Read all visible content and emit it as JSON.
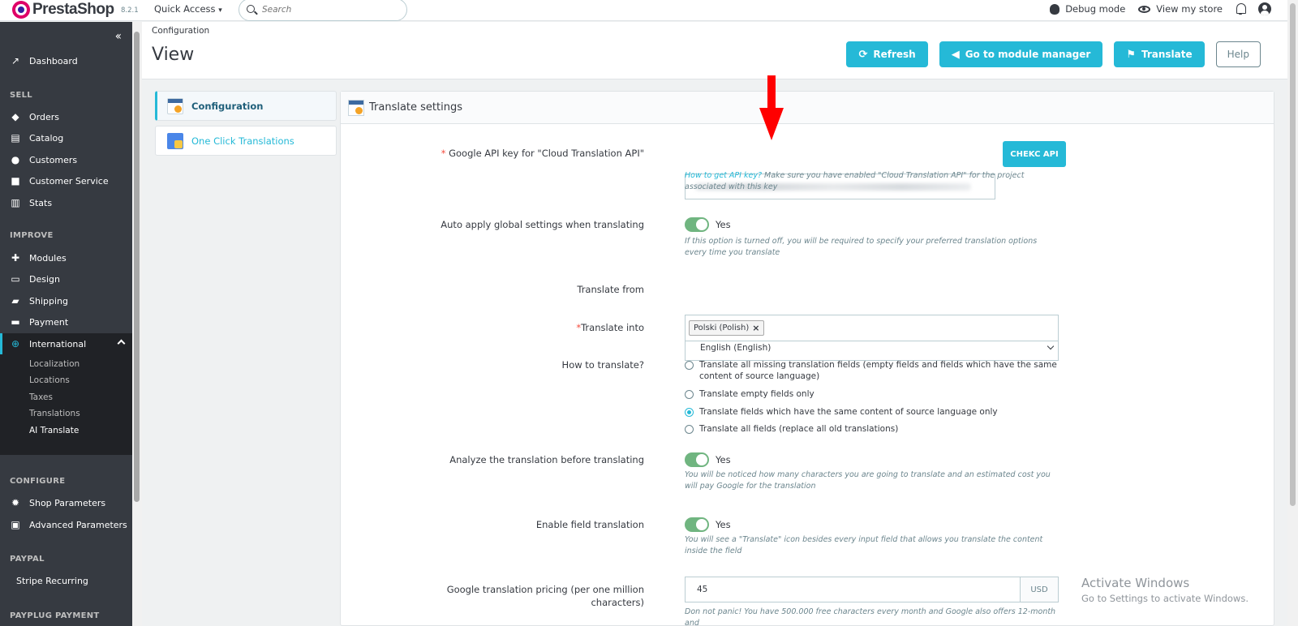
{
  "topbar": {
    "brand": "PrestaShop",
    "version": "8.2.1",
    "quick_access": "Quick Access",
    "search_placeholder": "Search",
    "debug_mode": "Debug mode",
    "view_store": "View my store"
  },
  "sidebar": {
    "collapse_icon": "double-chevron-left",
    "dashboard": "Dashboard",
    "sections": {
      "sell": "SELL",
      "improve": "IMPROVE",
      "configure": "CONFIGURE",
      "paypal": "PAYPAL",
      "payplug": "PAYPLUG PAYMENT"
    },
    "sell_items": [
      "Orders",
      "Catalog",
      "Customers",
      "Customer Service",
      "Stats"
    ],
    "improve_items": [
      "Modules",
      "Design",
      "Shipping",
      "Payment",
      "International"
    ],
    "international_sub": [
      "Localization",
      "Locations",
      "Taxes",
      "Translations",
      "AI Translate"
    ],
    "configure_items": [
      "Shop Parameters",
      "Advanced Parameters"
    ],
    "paypal_items": [
      "Stripe Recurring"
    ]
  },
  "header": {
    "breadcrumb": "Configuration",
    "title": "View",
    "buttons": {
      "refresh": "Refresh",
      "module_manager": "Go to module manager",
      "translate": "Translate",
      "help": "Help"
    }
  },
  "tabs": [
    "Configuration",
    "One Click Translations"
  ],
  "panel": {
    "title": "Translate settings",
    "api_label": "Google API key for \"Cloud Translation API\"",
    "api_button": "CHEKC API",
    "api_help_link": "How to get API key?",
    "api_help": " Make sure you have enabled \"Cloud Translation API\" for the project associated with this key",
    "auto_label": "Auto apply global settings when translating",
    "auto_value": "Yes",
    "auto_help": "If this option is turned off, you will be required to specify your preferred translation options every time you translate",
    "from_label": "Translate from",
    "from_value": "English (English)",
    "into_label": "Translate into",
    "into_tag": "Polski (Polish)",
    "how_label": "How to translate?",
    "how_options": [
      "Translate all missing translation fields (empty fields and fields which have the same content of source language)",
      "Translate empty fields only",
      "Translate fields which have the same content of source language only",
      "Translate all fields (replace all old translations)"
    ],
    "how_selected": 2,
    "analyze_label": "Analyze the translation before translating",
    "analyze_value": "Yes",
    "analyze_help": "You will be noticed how many characters you are going to translate and an estimated cost you will pay Google for the translation",
    "field_label": "Enable field translation",
    "field_value": "Yes",
    "field_help": "You will see a \"Translate\" icon besides every input field that allows you translate the content inside the field",
    "pricing_label_1": "Google translation pricing (per one million",
    "pricing_label_2": "characters)",
    "pricing_value": "45",
    "pricing_unit": "USD",
    "pricing_help": "Don not panic! You have 500.000 free characters every month and Google also offers 12-month and"
  },
  "watermark": {
    "line1": "Activate Windows",
    "line2": "Go to Settings to activate Windows."
  },
  "colors": {
    "accent": "#25b9d7",
    "sidebar": "#363a41",
    "switch_on": "#70b580",
    "annotation_arrow": "#ff0000"
  }
}
